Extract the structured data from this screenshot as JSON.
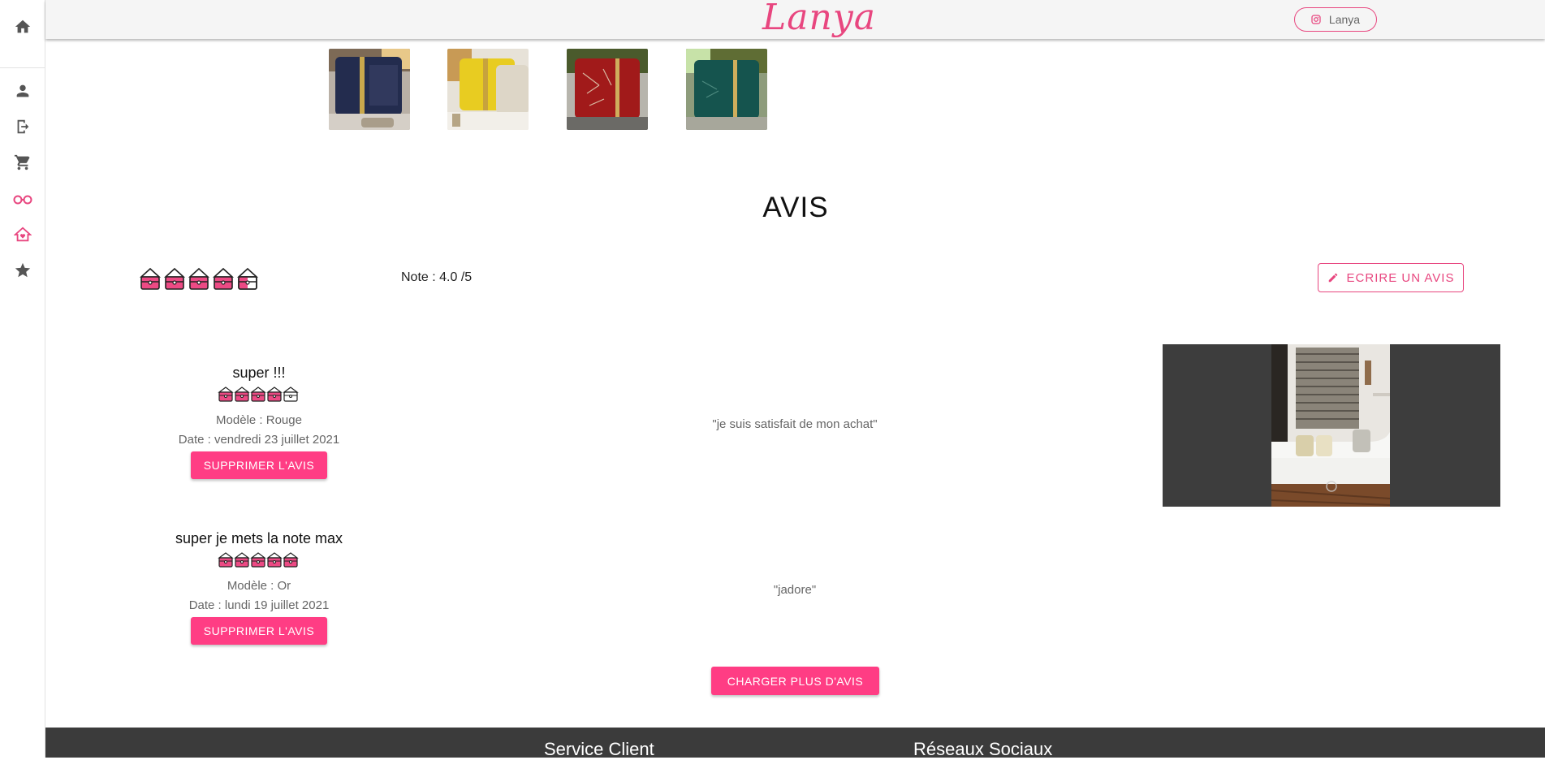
{
  "brand": {
    "logo": "Lanya",
    "instagram_label": "Lanya",
    "accent": "#e8467f",
    "button_color": "#ff3d84"
  },
  "sidebar": {
    "items": [
      "home-icon",
      "user-icon",
      "logout-icon",
      "cart-icon",
      "glasses-icon",
      "house-heart-icon",
      "star-icon"
    ]
  },
  "product": {
    "thumbnails": [
      "navy-cushion",
      "yellow-cushion",
      "red-cushion",
      "green-cushion"
    ]
  },
  "reviews_section": {
    "title": "AVIS",
    "rating_text": "Note : 4.0 /5",
    "rating": 4.0,
    "rating_max": 5,
    "write_button": "ECRIRE UN AVIS",
    "reviews": [
      {
        "title": "super !!!",
        "rating": 4,
        "model": "Modèle : Rouge",
        "date": "Date : vendredi 23 juillet 2021",
        "text": "\"je suis satisfait de mon achat\"",
        "delete_label": "SUPPRIMER L'AVIS"
      },
      {
        "title": "super je mets la note max",
        "rating": 5,
        "model": "Modèle : Or",
        "date": "Date : lundi 19 juillet 2021",
        "text": "\"jadore\"",
        "delete_label": "SUPPRIMER L'AVIS"
      }
    ],
    "load_more": "CHARGER PLUS D'AVIS"
  },
  "footer": {
    "service_client": "Service Client",
    "reseaux": "Réseaux Sociaux"
  }
}
